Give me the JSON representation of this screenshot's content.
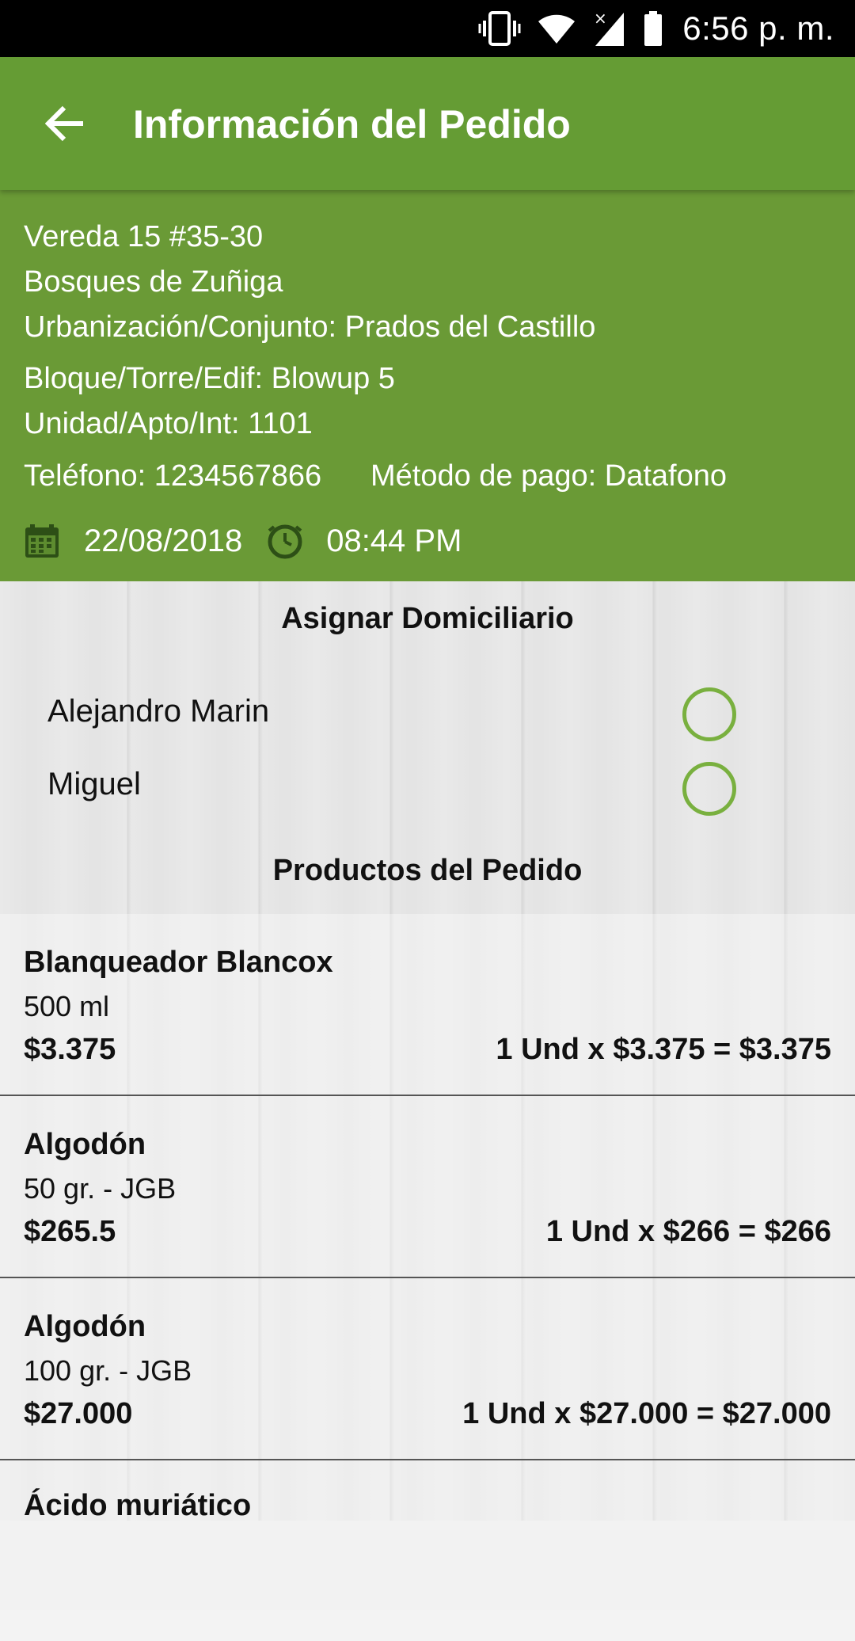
{
  "status_bar": {
    "time": "6:56 p. m.",
    "icons": [
      "vibrate-icon",
      "wifi-icon",
      "signal-icon",
      "battery-icon"
    ]
  },
  "app_bar": {
    "title": "Información del Pedido",
    "back_icon": "arrow-back-icon",
    "color": "#659c34"
  },
  "order": {
    "address": "Vereda 15 #35-30",
    "neighborhood": "Bosques de Zuñiga",
    "complex": "Urbanización/Conjunto: Prados del Castillo",
    "block": "Bloque/Torre/Edif: Blowup 5",
    "unit": "Unidad/Apto/Int: 1101",
    "phone": "Teléfono: 1234567866",
    "payment": "Método de pago: Datafono",
    "date": "22/08/2018",
    "time": "08:44 PM",
    "panel_color": "#6a9a36"
  },
  "assign_section": {
    "title": "Asignar Domiciliario",
    "couriers": [
      {
        "name": "Alejandro Marin",
        "selected": false
      },
      {
        "name": "Miguel",
        "selected": false
      }
    ]
  },
  "products_section": {
    "title": "Productos del Pedido",
    "items": [
      {
        "name": "Blanqueador Blancox",
        "size": "500 ml",
        "price": "$3.375",
        "total": "1 Und x $3.375 = $3.375"
      },
      {
        "name": "Algodón",
        "size": "50 gr. - JGB",
        "price": "$265.5",
        "total": "1 Und x $266 = $266"
      },
      {
        "name": "Algodón",
        "size": "100 gr. - JGB",
        "price": "$27.000",
        "total": "1 Und x $27.000 = $27.000"
      },
      {
        "name": "Ácido muriático"
      }
    ]
  }
}
